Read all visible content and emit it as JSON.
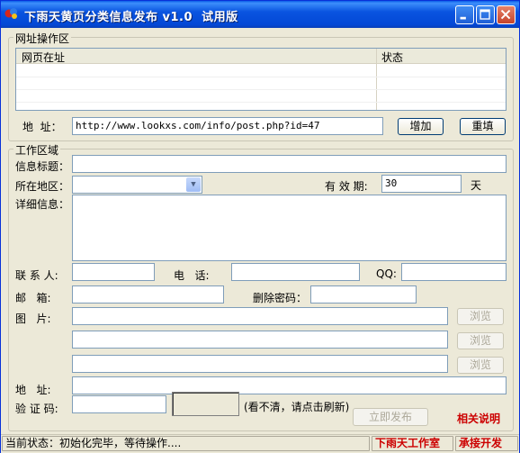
{
  "window": {
    "title": "下雨天黄页分类信息发布 v1.0  试用版",
    "minimize_icon": "minimize-icon",
    "maximize_icon": "maximize-icon",
    "close_icon": "close-icon"
  },
  "url_group": {
    "legend": "网址操作区",
    "columns": [
      "网页在址",
      "状态"
    ],
    "address_label": "地  址：",
    "address_value": "http://www.lookxs.com/info/post.php?id=47",
    "add_button": "增加",
    "refill_button": "重填"
  },
  "work_group": {
    "legend": "工作区域",
    "title_label": "信息标题：",
    "title_value": "",
    "region_label": "所在地区：",
    "region_value": "",
    "validity_label": "有 效 期:",
    "validity_value": "30",
    "validity_unit": "天",
    "detail_label": "详细信息：",
    "detail_value": "",
    "contact_label": "联 系 人:",
    "contact_value": "",
    "phone_label": "电   话:",
    "phone_value": "",
    "qq_label": "QQ:",
    "qq_value": "",
    "email_label": "邮   箱:",
    "email_value": "",
    "delete_pwd_label": "删除密码：",
    "delete_pwd_value": "",
    "picture_label": "图   片:",
    "browse_label": "浏览",
    "address_label": "地   址:",
    "address_value": "",
    "captcha_label": "验 证 码:",
    "captcha_value": "",
    "captcha_hint": "(看不清，请点击刷新)",
    "publish_button": "立即发布",
    "help_link": "相关说明"
  },
  "status": {
    "left": "当前状态：初始化完毕，等待操作....",
    "studio": "下雨天工作室",
    "service": "承接开发"
  },
  "colors": {
    "title_bar": "#0a54e0",
    "window_bg": "#ece9d8",
    "link_red": "#cc0000",
    "input_border": "#7f9db9"
  }
}
